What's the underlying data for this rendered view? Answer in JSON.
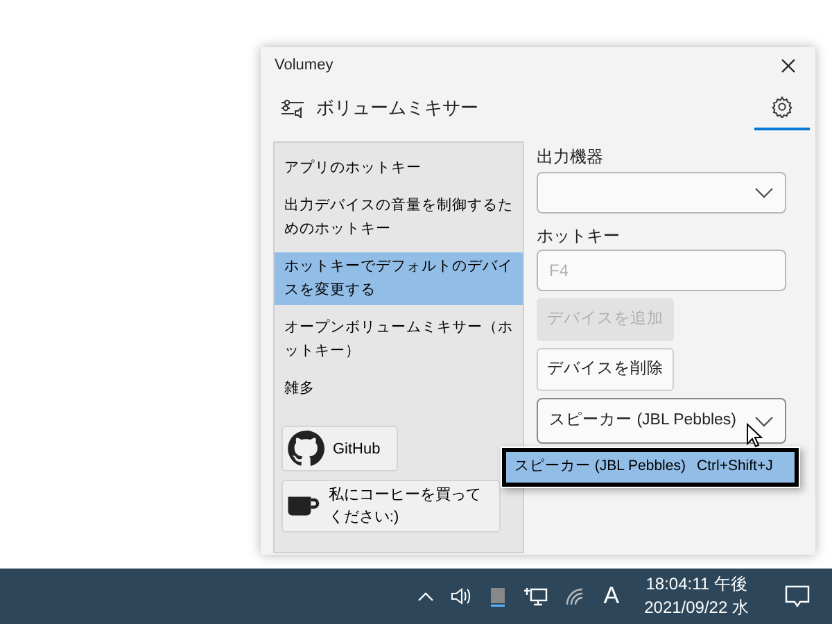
{
  "window": {
    "title": "Volumey"
  },
  "header": {
    "title": "ボリュームミキサー",
    "settings_selected": true
  },
  "sidebar": {
    "items": [
      {
        "label": "アプリのホットキー",
        "selected": false
      },
      {
        "label": "出力デバイスの音量を制御するためのホットキー",
        "selected": false
      },
      {
        "label": "ホットキーでデフォルトのデバイスを変更する",
        "selected": true
      },
      {
        "label": "オープンボリュームミキサー（ホットキー）",
        "selected": false
      },
      {
        "label": "雑多",
        "selected": false
      }
    ],
    "links": [
      {
        "kind": "github",
        "label": "GitHub"
      },
      {
        "kind": "coffee",
        "label": "私にコーヒーを買ってください:)"
      }
    ]
  },
  "form": {
    "device_label": "出力機器",
    "hotkey_label": "ホットキー",
    "hotkey_placeholder": "F4",
    "buttons": [
      {
        "label": "デバイスを追加",
        "disabled": true
      },
      {
        "label": "デバイスを削除",
        "disabled": false
      }
    ],
    "combo": {
      "value": "スピーカー (JBL Pebbles)",
      "expanded": true,
      "options": [
        {
          "device": "スピーカー (JBL Pebbles)",
          "hotkey": "Ctrl+Shift+J",
          "selected": true
        }
      ]
    }
  },
  "taskbar": {
    "ime": "A",
    "time": "18:04:11 午後",
    "date": "2021/09/22 水"
  }
}
